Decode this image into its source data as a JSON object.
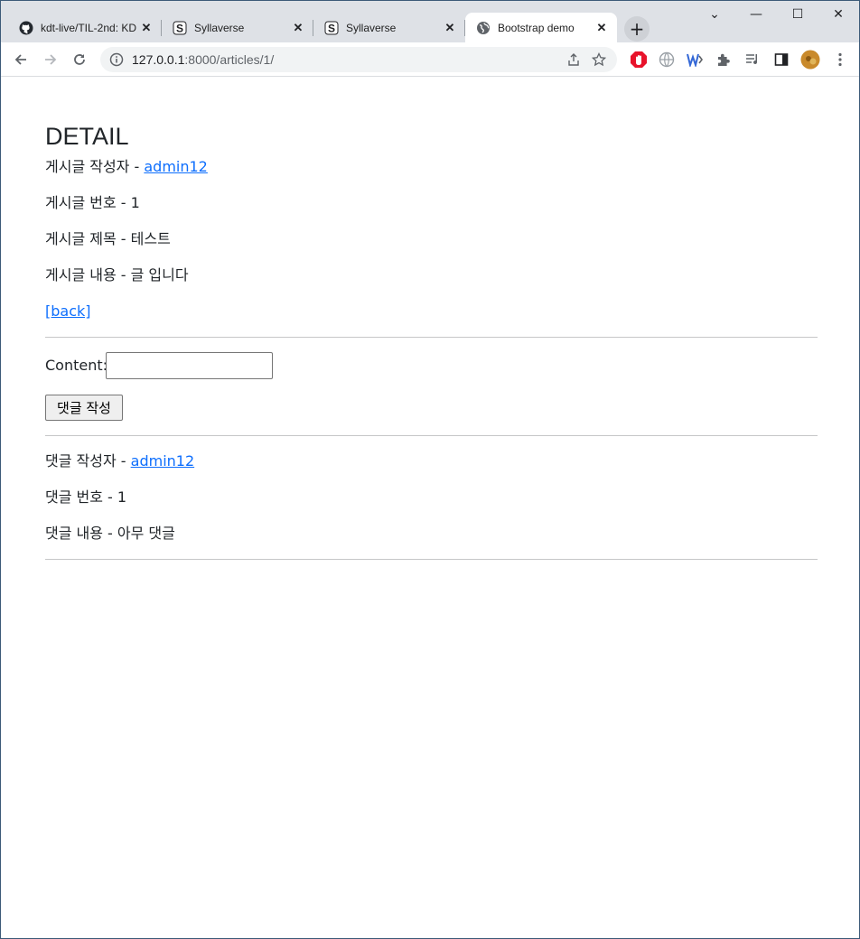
{
  "browser": {
    "tabs": [
      {
        "title": "kdt-live/TIL-2nd: KD",
        "favicon": "github-icon",
        "active": false
      },
      {
        "title": "Syllaverse",
        "favicon": "syllaverse-icon",
        "active": false
      },
      {
        "title": "Syllaverse",
        "favicon": "syllaverse-icon",
        "active": false
      },
      {
        "title": "Bootstrap demo",
        "favicon": "globe-icon",
        "active": true
      }
    ],
    "close_glyph": "✕",
    "new_tab_glyph": "+",
    "url_host": "127.0.0.1",
    "url_path": ":8000/articles/1/",
    "window_controls": {
      "minimize": "—",
      "maximize": "☐",
      "close": "✕",
      "tab_search": "⌄"
    }
  },
  "article": {
    "heading": "DETAIL",
    "author_label": "게시글 작성자 - ",
    "author_name": "admin12",
    "number_line": "게시글 번호 - 1",
    "title_line": "게시글 제목 - 테스트",
    "content_line": "게시글 내용 - 글 입니다",
    "back_link": "[back]"
  },
  "comment_form": {
    "content_label": "Content:",
    "content_value": "",
    "submit_label": "댓글 작성"
  },
  "comments": [
    {
      "author_label": "댓글 작성자 - ",
      "author_name": "admin12",
      "number_line": "댓글 번호 - 1",
      "content_line": "댓글 내용 - 아무 댓글"
    }
  ],
  "colors": {
    "link": "#0d6efd",
    "text": "#212529",
    "tabstrip": "#dee1e6",
    "extension_red": "#e8132b",
    "profile_avatar": "#c98a2b"
  }
}
